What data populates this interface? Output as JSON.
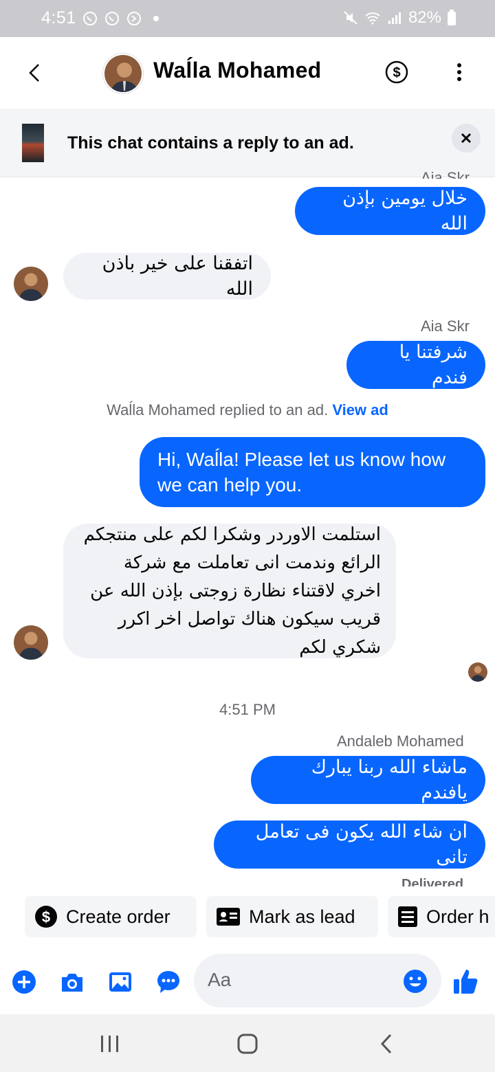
{
  "status_bar": {
    "time": "4:51",
    "battery": "82%"
  },
  "header": {
    "contact_name": "Waĺla Mohamed"
  },
  "ad_banner": {
    "text": "This chat contains a reply to an ad."
  },
  "messages": [
    {
      "sender": "Aia Skr",
      "text": "خلال يومين بإذن الله"
    },
    {
      "text": "اتفقنا على خير باذن الله"
    },
    {
      "sender": "Aia Skr",
      "text": "شرفتنا يا فندم"
    },
    {
      "system": "Waĺla Mohamed replied to an ad.",
      "link": "View ad"
    },
    {
      "text": "Hi, Waĺla! Please let us know how we can help you."
    },
    {
      "text": "استلمت الاوردر وشكرا لكم على منتجكم الرائع وندمت انى تعاملت مع شركة اخري لاقتناء نظارة زوجتى بإذن الله عن قريب سيكون هناك تواصل اخر اكرر شكري لكم"
    },
    {
      "timestamp": "4:51 PM"
    },
    {
      "sender": "Andaleb Mohamed",
      "text": "ماشاء الله ربنا يبارك يافندم"
    },
    {
      "text": "ان شاء الله يكون فى تعامل تانى"
    }
  ],
  "delivered_label": "Delivered",
  "quick_actions": [
    {
      "label": "Create order",
      "icon": "dollar-circle-icon"
    },
    {
      "label": "Mark as lead",
      "icon": "id-card-icon"
    },
    {
      "label": "Order h",
      "icon": "list-icon"
    }
  ],
  "composer": {
    "placeholder": "Aa"
  },
  "colors": {
    "accent": "#0866ff",
    "incoming_bubble": "#f0f2f5",
    "status_bar": "#c9c9ce"
  }
}
